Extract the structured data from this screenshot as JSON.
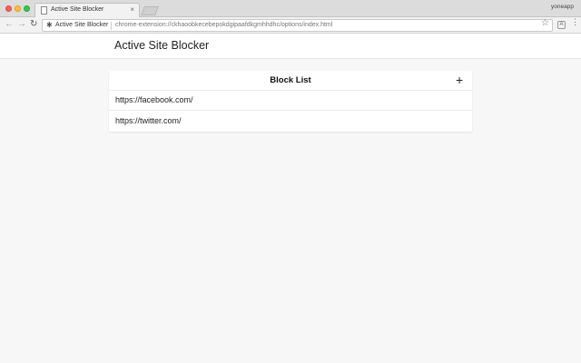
{
  "browser": {
    "tab_title": "Active Site Blocker",
    "tab_close": "×",
    "profile_name": "yoneapp",
    "address": {
      "extension_name": "Active Site Blocker",
      "url": "chrome-extension://ckhaoobkecebepokdgipaafdkgmhhdhc/options/index.html"
    },
    "icons": {
      "back": "←",
      "forward": "→",
      "reload": "↻",
      "star": "☆",
      "extension": "✱",
      "ext_button": "A",
      "menu": "⋮"
    }
  },
  "app": {
    "title": "Active Site Blocker"
  },
  "block_list": {
    "title": "Block List",
    "add_label": "+",
    "items": [
      {
        "url": "https://facebook.com/"
      },
      {
        "url": "https://twitter.com/"
      }
    ]
  },
  "colors": {
    "page_background": "#f7f7f7",
    "card_background": "#ffffff",
    "text": "#222222"
  }
}
